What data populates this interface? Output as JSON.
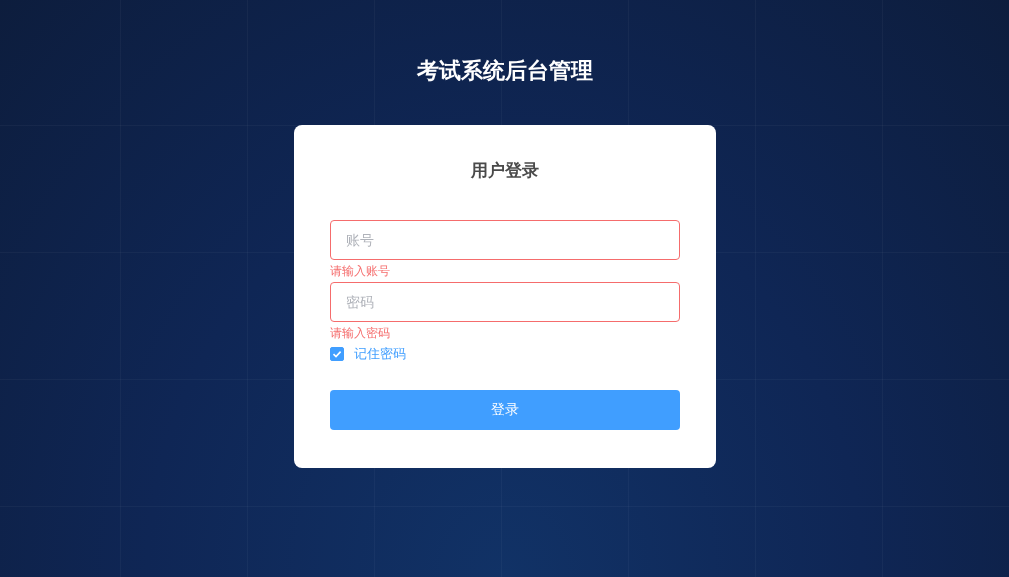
{
  "page_title": "考试系统后台管理",
  "login_card": {
    "heading": "用户登录",
    "fields": [
      {
        "placeholder": "账号",
        "invalid": true,
        "error": "请输入账号"
      },
      {
        "placeholder": "密码",
        "invalid": true,
        "error": "请输入密码"
      }
    ],
    "remember": {
      "label": "记住密码",
      "checked": true
    },
    "submit_button": "登录"
  }
}
